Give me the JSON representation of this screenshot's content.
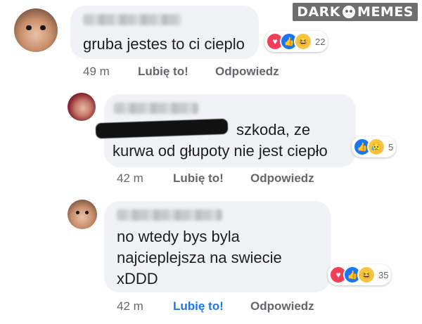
{
  "watermark": {
    "left": "DARK",
    "right": "MEMES"
  },
  "comments": [
    {
      "lines": [
        "gruba jestes to ci cieplo"
      ],
      "reactions": {
        "types": [
          "love",
          "like",
          "haha"
        ],
        "count": "22"
      },
      "time": "49 m",
      "like_label": "Lubię to!",
      "reply_label": "Odpowiedz",
      "liked": false
    },
    {
      "lines": [
        "szkoda, ze",
        "kurwa od głupoty nie jest ciepło"
      ],
      "reactions": {
        "types": [
          "like",
          "sad"
        ],
        "count": "5"
      },
      "time": "42 m",
      "like_label": "Lubię to!",
      "reply_label": "Odpowiedz",
      "liked": false
    },
    {
      "lines": [
        "no wtedy bys byla",
        "najcieplejsza na swiecie",
        "xDDD"
      ],
      "reactions": {
        "types": [
          "love",
          "like",
          "haha"
        ],
        "count": "35"
      },
      "time": "42 m",
      "like_label": "Lubię to!",
      "reply_label": "Odpowiedz",
      "liked": true
    }
  ],
  "colors": {
    "bubble": "#f0f2f5",
    "meta": "#65676b",
    "liked": "#1877f2"
  }
}
